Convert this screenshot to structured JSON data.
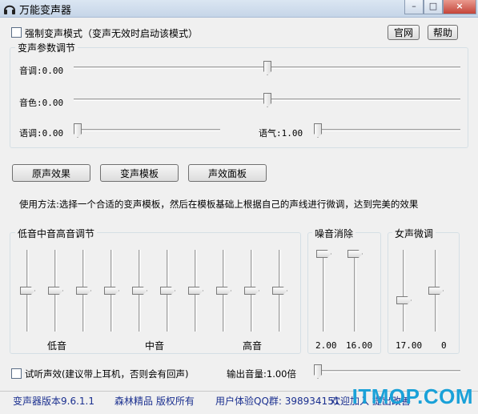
{
  "window": {
    "title": "万能变声器",
    "minimize": "–",
    "maximize": "□",
    "close": "×"
  },
  "top": {
    "force_mode_label": "强制变声模式（变声无效时启动该模式）",
    "official_site": "官网",
    "help": "帮助"
  },
  "params": {
    "group_title": "变声参数调节",
    "pitch": {
      "label": "音调:0.00",
      "value": 0.0
    },
    "timbre": {
      "label": "音色:0.00",
      "value": 0.0
    },
    "speed": {
      "label": "语调:0.00",
      "value": 0.0
    },
    "tone": {
      "label": "语气:1.00",
      "value": 1.0
    }
  },
  "buttons": {
    "original": "原声效果",
    "templates": "变声模板",
    "effects": "声效面板"
  },
  "usage": "使用方法:选择一个合适的变声模板，然后在模板基础上根据自己的声线进行微调，达到完美的效果",
  "eq": {
    "title": "低音中音高音调节",
    "low": "低音",
    "mid": "中音",
    "high": "高音",
    "band_count": 10
  },
  "noise": {
    "title": "噪音消除",
    "values": [
      "2.00",
      "16.00"
    ]
  },
  "female": {
    "title": "女声微调",
    "values": [
      "17.00",
      "0"
    ]
  },
  "monitor": {
    "label": "试听声效(建议带上耳机，否则会有回声)",
    "volume_label": "输出音量:1.00倍"
  },
  "status": {
    "version": "变声器版本9.6.1.1",
    "copyright": "森林精品 版权所有",
    "qq": "用户体验QQ群: 398934151",
    "welcome": "欢迎加入 提出改善"
  },
  "watermark": "ITMOP.COM"
}
